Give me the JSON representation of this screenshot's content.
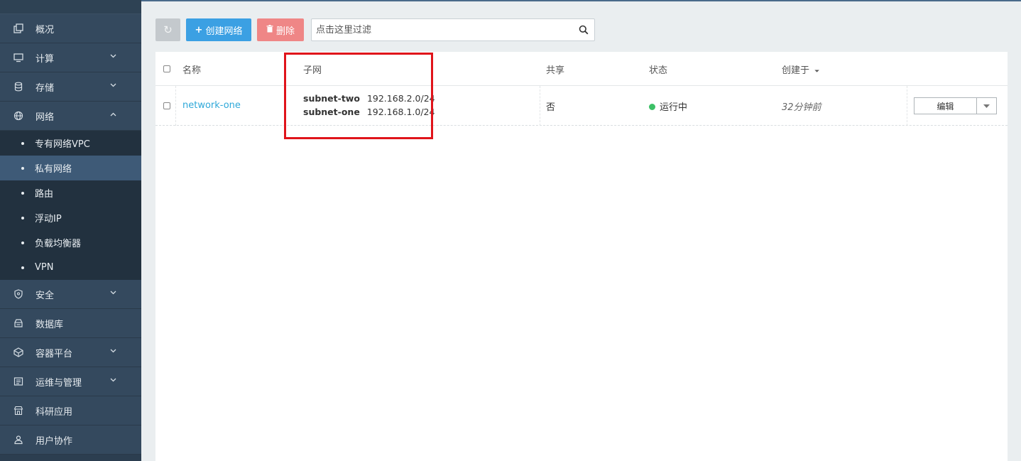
{
  "sidebar": {
    "items": [
      {
        "label": "概况",
        "icon": "overview-icon",
        "chevron": ""
      },
      {
        "label": "计算",
        "icon": "monitor-icon",
        "chevron": "⌄"
      },
      {
        "label": "存储",
        "icon": "database-icon",
        "chevron": "⌄"
      },
      {
        "label": "网络",
        "icon": "network-icon",
        "chevron": "⌃"
      }
    ],
    "network_sub": [
      {
        "label": "专有网络VPC"
      },
      {
        "label": "私有网络"
      },
      {
        "label": "路由"
      },
      {
        "label": "浮动IP"
      },
      {
        "label": "负载均衡器"
      },
      {
        "label": "VPN"
      }
    ],
    "items_after": [
      {
        "label": "安全",
        "icon": "shield-icon",
        "chevron": "⌄"
      },
      {
        "label": "数据库",
        "icon": "db-icon",
        "chevron": ""
      },
      {
        "label": "容器平台",
        "icon": "container-icon",
        "chevron": "⌄"
      },
      {
        "label": "运维与管理",
        "icon": "ops-icon",
        "chevron": "⌄"
      },
      {
        "label": "科研应用",
        "icon": "store-icon",
        "chevron": ""
      },
      {
        "label": "用户协作",
        "icon": "users-icon",
        "chevron": ""
      }
    ]
  },
  "toolbar": {
    "refresh_icon": "↻",
    "create_label": "创建网络",
    "create_prefix": "+",
    "delete_label": "删除",
    "delete_prefix": "🗑",
    "search_placeholder": "点击这里过滤"
  },
  "table": {
    "headers": {
      "name": "名称",
      "subnet": "子网",
      "shared": "共享",
      "status": "状态",
      "created": "创建于",
      "sort_icon": "⏷"
    },
    "rows": [
      {
        "name": "network-one",
        "subnets": [
          {
            "name": "subnet-two",
            "cidr": "192.168.2.0/24"
          },
          {
            "name": "subnet-one",
            "cidr": "192.168.1.0/24"
          }
        ],
        "shared": "否",
        "status": "运行中",
        "created": "32分钟前",
        "action": "编辑"
      }
    ]
  },
  "colors": {
    "sidebar_bg": "#34495e",
    "active_item": "#3e5a77",
    "create_btn": "#3ba0e3",
    "delete_btn": "#ef8686",
    "status_running": "#3cc066",
    "highlight": "#e0141b",
    "link": "#2ea8d9"
  }
}
